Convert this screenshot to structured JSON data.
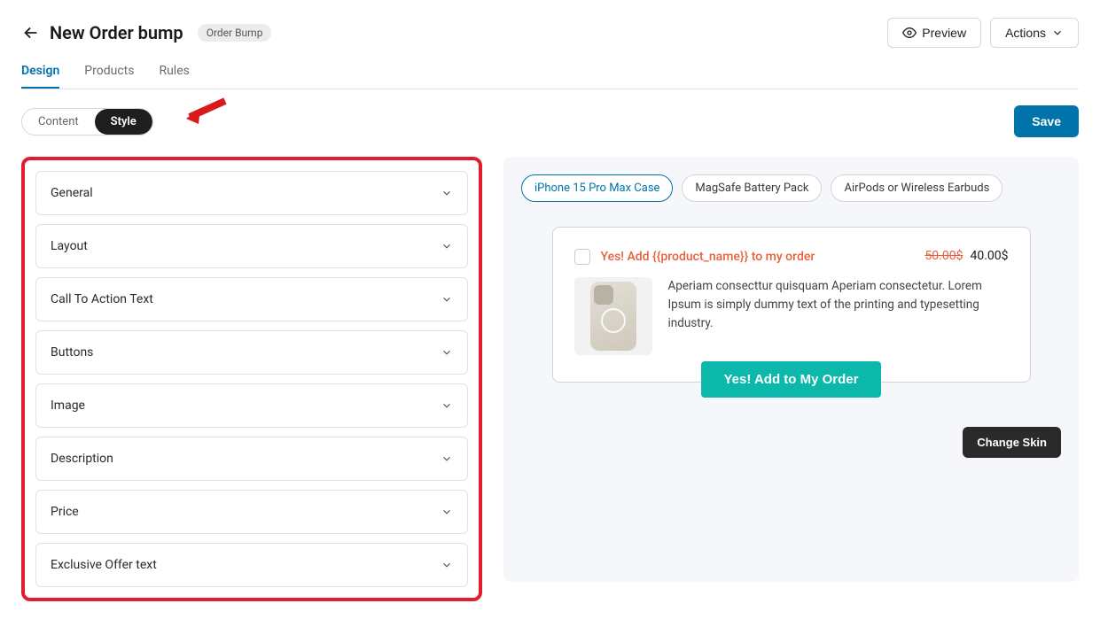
{
  "header": {
    "title": "New Order bump",
    "badge": "Order Bump",
    "preview_label": "Preview",
    "actions_label": "Actions"
  },
  "tabs": {
    "design": "Design",
    "products": "Products",
    "rules": "Rules"
  },
  "toggle": {
    "content": "Content",
    "style": "Style"
  },
  "save_label": "Save",
  "accordion": [
    {
      "label": "General"
    },
    {
      "label": "Layout"
    },
    {
      "label": "Call To Action Text"
    },
    {
      "label": "Buttons"
    },
    {
      "label": "Image"
    },
    {
      "label": "Description"
    },
    {
      "label": "Price"
    },
    {
      "label": "Exclusive Offer text"
    }
  ],
  "pills": [
    {
      "label": "iPhone 15 Pro Max Case"
    },
    {
      "label": "MagSafe Battery Pack"
    },
    {
      "label": "AirPods or Wireless Earbuds"
    }
  ],
  "offer": {
    "cta_text": "Yes! Add {{product_name}} to my order",
    "old_price": "50.00$",
    "new_price": "40.00$",
    "description": "Aperiam consecttur quisquam Aperiam consectetur. Lorem Ipsum is simply dummy text of the printing and typesetting industry.",
    "add_button": "Yes! Add to My Order"
  },
  "change_skin": "Change Skin"
}
